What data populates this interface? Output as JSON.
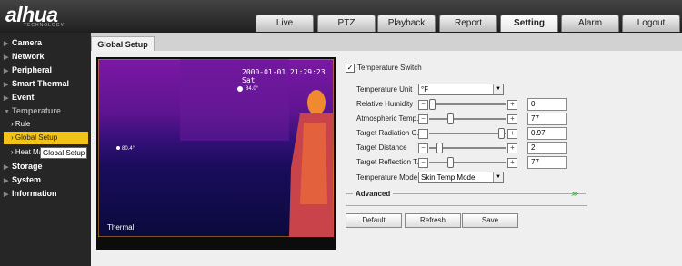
{
  "brand": {
    "name": "alhua",
    "sub": "TECHNOLOGY"
  },
  "tabs": [
    {
      "label": "Live"
    },
    {
      "label": "PTZ"
    },
    {
      "label": "Playback"
    },
    {
      "label": "Report"
    },
    {
      "label": "Setting"
    },
    {
      "label": "Alarm"
    },
    {
      "label": "Logout"
    }
  ],
  "sidebar": {
    "items": [
      {
        "label": "Camera"
      },
      {
        "label": "Network"
      },
      {
        "label": "Peripheral"
      },
      {
        "label": "Smart Thermal"
      },
      {
        "label": "Event"
      },
      {
        "label": "Temperature"
      },
      {
        "label": "Storage"
      },
      {
        "label": "System"
      },
      {
        "label": "Information"
      }
    ],
    "sub": [
      {
        "label": "Rule"
      },
      {
        "label": "Global Setup"
      },
      {
        "label": "Heat Map"
      }
    ],
    "tooltip": "Global Setup"
  },
  "page_tab": "Global Setup",
  "video": {
    "timestamp": "2000-01-01 21:29:23 Sat",
    "label": "Thermal",
    "temp1": "84.0°",
    "temp2": "80.4°"
  },
  "form": {
    "temperature_switch": "Temperature Switch",
    "temperature_switch_checked": true,
    "unit_label": "Temperature Unit",
    "unit_value": "°F",
    "humidity_label": "Relative Humidity",
    "humidity_value": "0",
    "humidity_pos": 0.0,
    "atm_label": "Atmospheric Temp...",
    "atm_value": "77",
    "atm_pos": 0.25,
    "radiation_label": "Target Radiation C...",
    "radiation_value": "0.97",
    "radiation_pos": 0.97,
    "distance_label": "Target Distance",
    "distance_value": "2",
    "distance_pos": 0.1,
    "reflection_label": "Target Reflection T...",
    "reflection_value": "77",
    "reflection_pos": 0.25,
    "mode_label": "Temperature Mode",
    "mode_value": "Skin Temp Mode",
    "advanced_label": "Advanced"
  },
  "buttons": {
    "default": "Default",
    "refresh": "Refresh",
    "save": "Save"
  }
}
